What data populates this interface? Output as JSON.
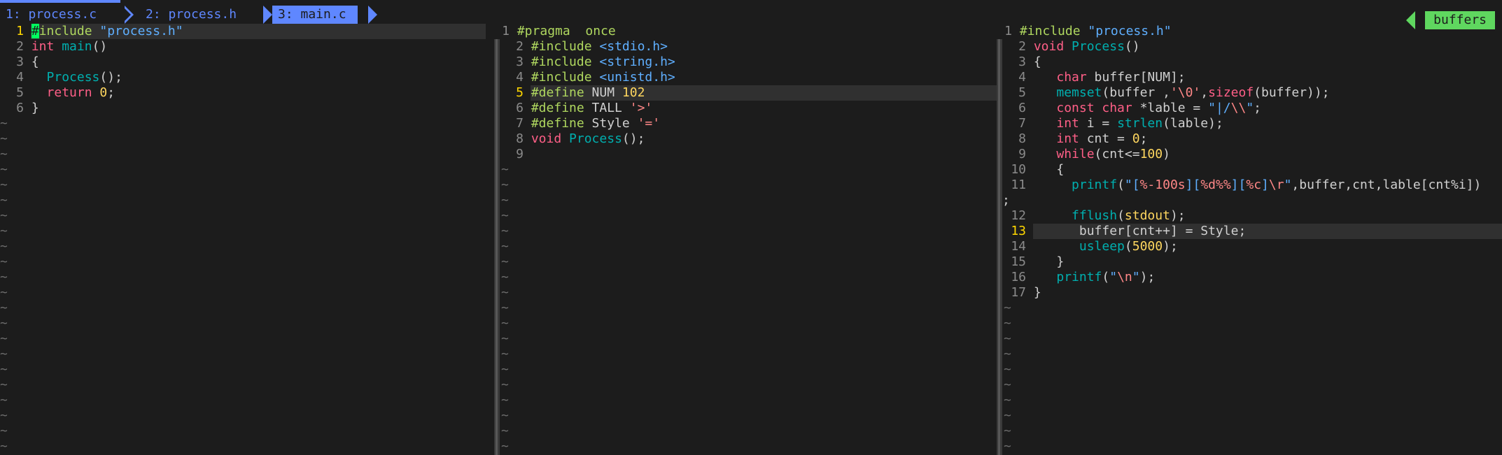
{
  "tabs": [
    {
      "label": "1: process.c",
      "active": false
    },
    {
      "label": "2: process.h",
      "active": false
    },
    {
      "label": "3: main.c",
      "active": true
    }
  ],
  "buffers_label": "buffers",
  "tilde_char": "~",
  "colors": {
    "accent": "#5f87ff",
    "buffers": "#5fd75f",
    "background": "#1c1c1c"
  },
  "panes": {
    "left": {
      "current_line": 1,
      "lines": [
        "#include \"process.h\"",
        "int main()",
        "{",
        "  Process();",
        "  return 0;",
        "}"
      ]
    },
    "middle": {
      "current_line": 5,
      "lines": [
        "#pragma  once",
        "#include <stdio.h>",
        "#include <string.h>",
        "#include <unistd.h>",
        "#define NUM 102",
        "#define TALL '>'",
        "#define Style '='",
        "void Process();",
        ""
      ]
    },
    "right": {
      "current_line": 13,
      "lines": [
        "#include \"process.h\"",
        "void Process()",
        "{",
        "   char buffer[NUM];",
        "   memset(buffer ,'\\0',sizeof(buffer));",
        "   const char *lable = \"|/\\\\\";",
        "   int i = strlen(lable);",
        "   int cnt = 0;",
        "   while(cnt<=100)",
        "   {",
        "     printf(\"[%-100s][%d%%][%c]\\r\",buffer,cnt,lable[cnt%i])",
        "     fflush(stdout);",
        "      buffer[cnt++] = Style;",
        "      usleep(5000);",
        "   }",
        "   printf(\"\\n\");",
        "}"
      ],
      "wrap_continuation": ";"
    }
  }
}
